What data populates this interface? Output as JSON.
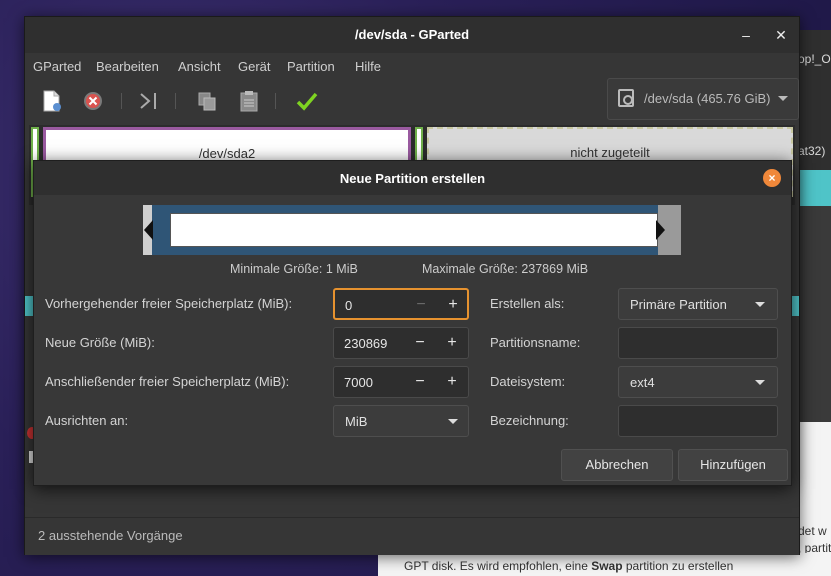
{
  "background": {
    "right_title": "op!_O",
    "right_sub": "at32)",
    "bottom_line_prefix": "GPT disk. Es wird empfohlen, eine ",
    "bottom_line_bold": "Swap",
    "bottom_line_suffix": " partition zu erstellen",
    "right_text_1": "det w",
    "right_text_2": ", partitio"
  },
  "window": {
    "title": "/dev/sda - GParted",
    "minimize_label": "–",
    "close_label": "✕"
  },
  "menu": [
    "GParted",
    "Bearbeiten",
    "Ansicht",
    "Gerät",
    "Partition",
    "Hilfe"
  ],
  "toolbar": {
    "icons": [
      "new-partition-icon",
      "delete-icon",
      "resize-move-icon",
      "copy-icon",
      "paste-icon",
      "apply-icon"
    ]
  },
  "device_selector": {
    "label": "/dev/sda (465.76 GiB)"
  },
  "partition_map": {
    "sda2_label": "/dev/sda2",
    "unallocated_label": "nicht zugeteilt"
  },
  "statusbar": {
    "text": "2 ausstehende Vorgänge"
  },
  "dialog": {
    "title": "Neue Partition erstellen",
    "close_label": "×",
    "min_size": "Minimale Größe: 1 MiB",
    "max_size": "Maximale Größe: 237869 MiB",
    "fields": {
      "free_before_label": "Vorhergehender freier Speicherplatz (MiB):",
      "free_before_value": "0",
      "new_size_label": "Neue Größe (MiB):",
      "new_size_value": "230869",
      "free_after_label": "Anschließender freier Speicherplatz (MiB):",
      "free_after_value": "7000",
      "align_label": "Ausrichten an:",
      "align_value": "MiB",
      "create_as_label": "Erstellen als:",
      "create_as_value": "Primäre Partition",
      "partition_name_label": "Partitionsname:",
      "partition_name_value": "",
      "filesystem_label": "Dateisystem:",
      "filesystem_value": "ext4",
      "label_label": "Bezeichnung:",
      "label_value": ""
    },
    "spin_minus": "−",
    "spin_plus": "+",
    "cancel_label": "Abbrechen",
    "add_label": "Hinzufügen"
  },
  "colors": {
    "accent_focus": "#e6922f",
    "partition_ext4_border": "#9a5aa0",
    "partition_green": "#6fb04a",
    "size_bar": "#2f5576",
    "close_button": "#f0883a",
    "apply_check": "#7ed321"
  }
}
